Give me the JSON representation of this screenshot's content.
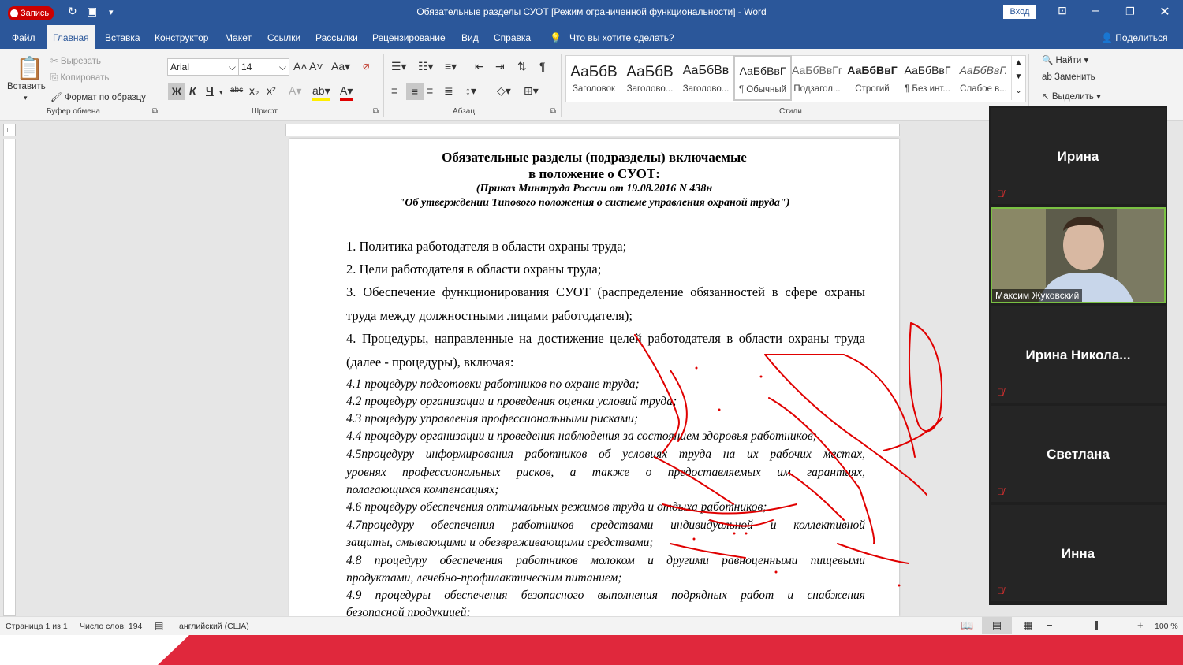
{
  "window": {
    "title": "Обязательные разделы СУОТ [Режим ограниченной функциональности]  -  Word",
    "record_label": "Запись",
    "signin_label": "Вход"
  },
  "tabs": [
    "Файл",
    "Главная",
    "Вставка",
    "Конструктор",
    "Макет",
    "Ссылки",
    "Рассылки",
    "Рецензирование",
    "Вид",
    "Справка"
  ],
  "tell_me": "Что вы хотите сделать?",
  "share": "Поделиться",
  "ribbon": {
    "clipboard": {
      "paste": "Вставить",
      "cut": "Вырезать",
      "copy": "Копировать",
      "format_painter": "Формат по образцу",
      "group": "Буфер обмена"
    },
    "font": {
      "name": "Arial",
      "size": "14",
      "group": "Шрифт",
      "bold": "Ж",
      "italic": "К",
      "underline": "Ч",
      "strike": "abc"
    },
    "paragraph": {
      "group": "Абзац"
    },
    "styles": {
      "group": "Стили",
      "items": [
        {
          "preview": "АаБбВ",
          "name": "Заголовок"
        },
        {
          "preview": "АаБбВ",
          "name": "Заголово..."
        },
        {
          "preview": "АаБбВв",
          "name": "Заголово..."
        },
        {
          "preview": "АаБбВвГ",
          "name": "¶ Обычный"
        },
        {
          "preview": "АаБбВвГг",
          "name": "Подзагол..."
        },
        {
          "preview": "АаБбВвГ",
          "name": "Строгий"
        },
        {
          "preview": "АаБбВвГ",
          "name": "¶ Без инт..."
        },
        {
          "preview": "АаБбВвГ.",
          "name": "Слабое в..."
        }
      ]
    },
    "editing": {
      "find": "Найти",
      "replace": "Заменить",
      "select": "Выделить"
    }
  },
  "document": {
    "title1": "Обязательные разделы (подразделы) включаемые",
    "title2": "в положение о СУОТ:",
    "sub1": "(Приказ Минтруда России от 19.08.2016 N 438н",
    "sub2": "\"Об утверждении Типового положения о системе управления охраной труда\")",
    "p1": "1. Политика работодателя в области охраны труда;",
    "p2": "2. Цели работодателя в области охраны труда;",
    "p3a": "3. Обеспечение функционирования СУОТ (распределение обязанностей в сфере охраны",
    "p3b": "труда между должностными лицами работодателя);",
    "p4a": "4. Процедуры, направленные на достижение целей работодателя в области охраны труда",
    "p4b": "(далее - процедуры), включая:",
    "i41": "4.1 процедуру подготовки работников по охране труда;",
    "i42": "4.2 процедуру организации и проведения оценки условий труда;",
    "i43": "4.3 процедуру управления профессиональными рисками;",
    "i44": "4.4 процедуру организации и проведения наблюдения за состоянием здоровья работников;",
    "i45a": "4.5процедуру информирования работников об условиях труда на их рабочих местах,",
    "i45b": "уровнях профессиональных рисков, а также о предоставляемых им гарантиях,",
    "i45c": "полагающихся компенсациях;",
    "i46": "4.6 процедуру обеспечения оптимальных режимов труда и отдыха работников;",
    "i47a": "4.7процедуру обеспечения работников средствами индивидуальной и коллективной",
    "i47b": "защиты, смывающими и обезвреживающими средствами;",
    "i48a": "4.8 процедуру обеспечения работников молоком и другими равноценными пищевыми",
    "i48b": "продуктами, лечебно-профилактическим питанием;",
    "i49a": "4.9 процедуры обеспечения безопасного выполнения подрядных работ и снабжения",
    "i49b": "безопасной продукцией;"
  },
  "participants": [
    {
      "name": "Ирина",
      "video": false
    },
    {
      "name": "Максим Жуковский",
      "video": true
    },
    {
      "name": "Ирина Никола...",
      "video": false
    },
    {
      "name": "Светлана",
      "video": false
    },
    {
      "name": "Инна",
      "video": false
    }
  ],
  "status": {
    "page": "Страница 1 из 1",
    "words": "Число слов: 194",
    "lang": "английский (США)",
    "zoom": "100 %"
  },
  "colors": {
    "accent": "#2b579a",
    "annotation": "#e00000",
    "bottom_bar": "#e0283c"
  }
}
